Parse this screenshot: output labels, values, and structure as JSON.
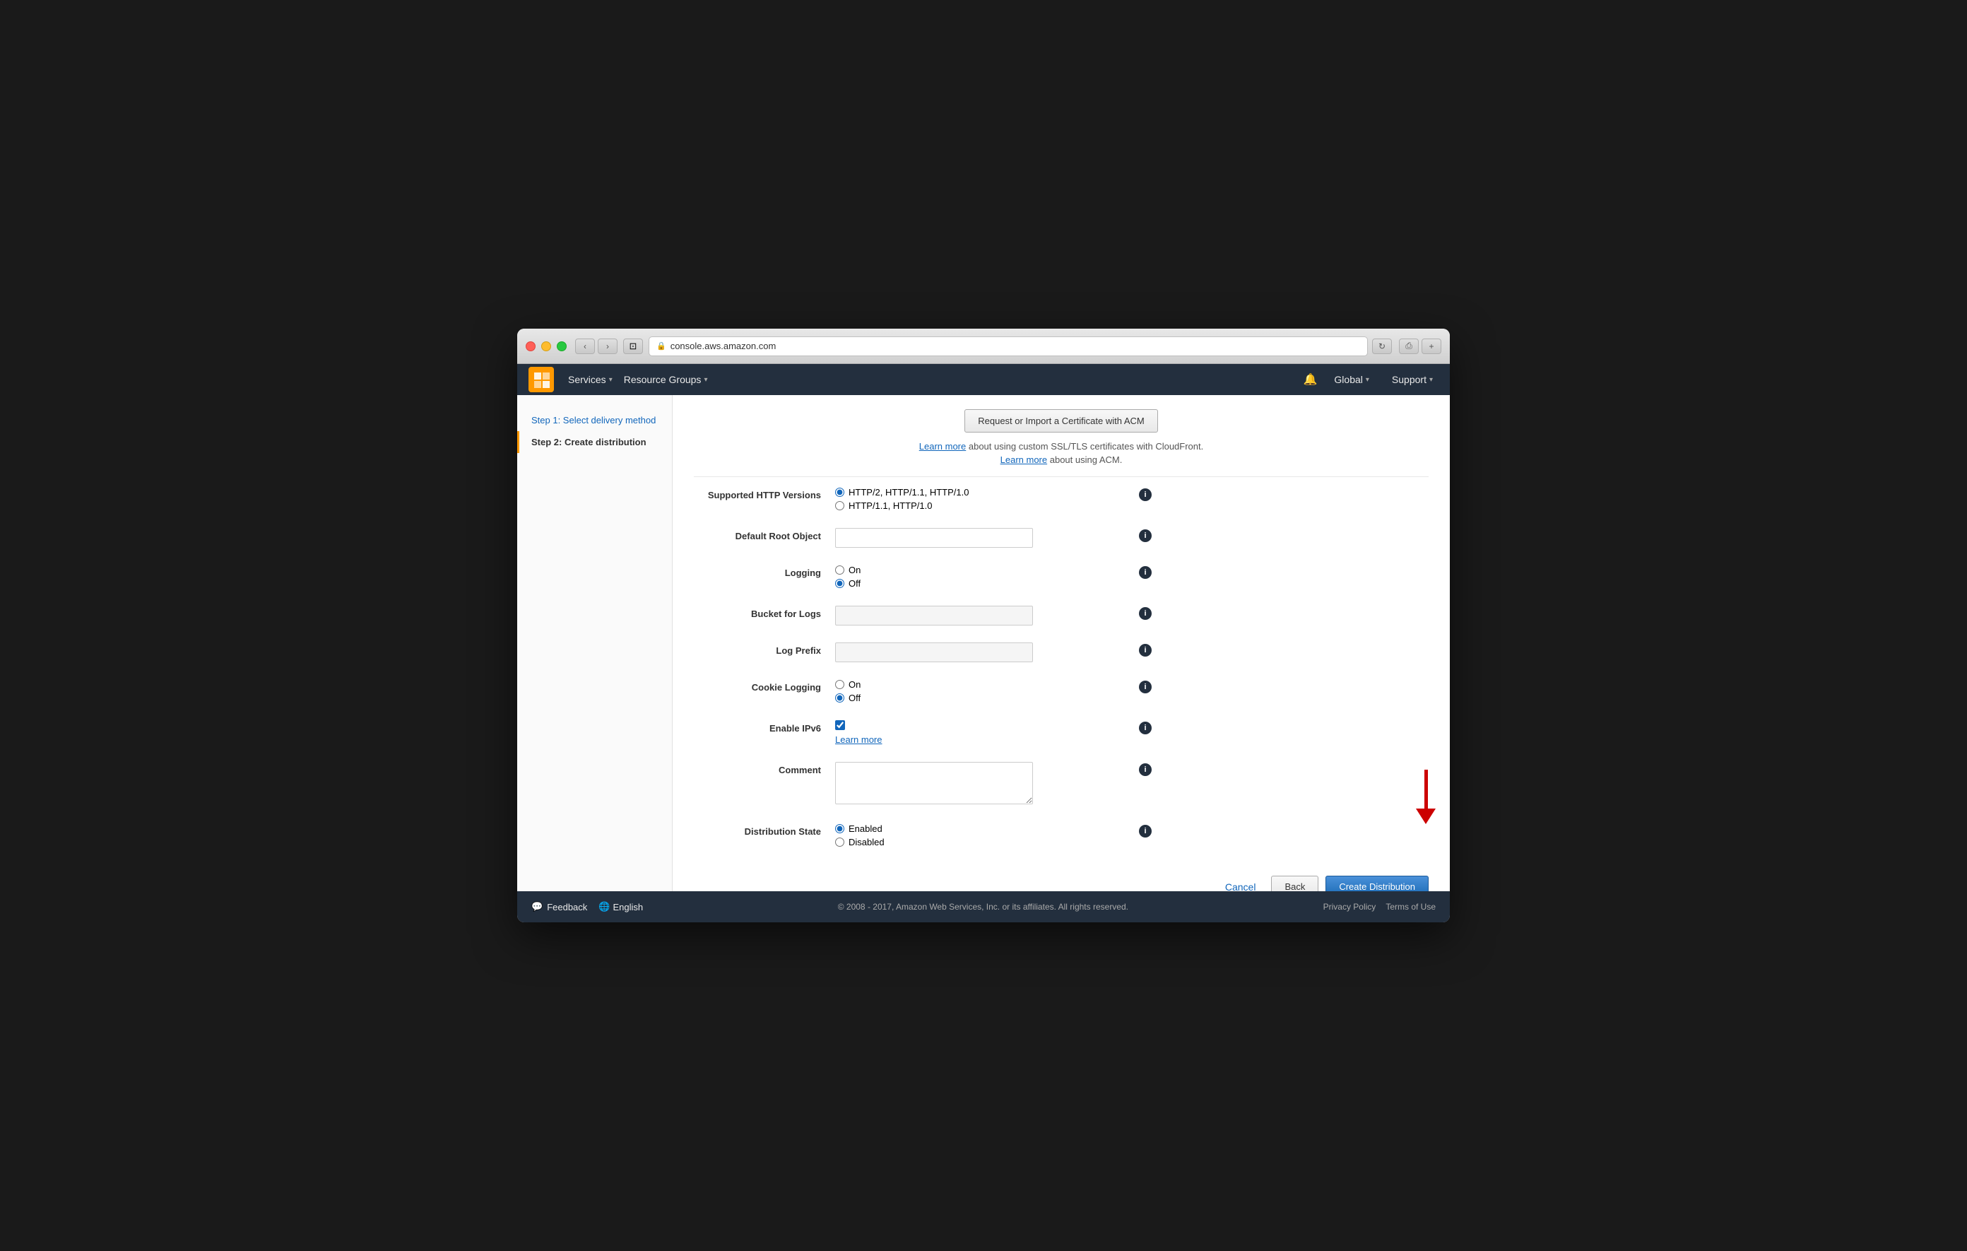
{
  "browser": {
    "url": "console.aws.amazon.com",
    "lock_icon": "🔒",
    "reload_icon": "↻",
    "back_icon": "‹",
    "forward_icon": "›",
    "window_icon": "⊡",
    "share_icon": "⎙",
    "plus_icon": "+"
  },
  "nav": {
    "logo_icon": "▣",
    "services_label": "Services",
    "resource_groups_label": "Resource Groups",
    "bell_icon": "🔔",
    "global_label": "Global",
    "support_label": "Support"
  },
  "sidebar": {
    "items": [
      {
        "label": "Step 1: Select delivery method",
        "type": "link"
      },
      {
        "label": "Step 2: Create distribution",
        "type": "active"
      }
    ]
  },
  "content": {
    "request_cert_btn": "Request or Import a Certificate with ACM",
    "learn_more_1": "Learn more",
    "learn_more_1_suffix": " about using custom SSL/TLS certificates with CloudFront.",
    "learn_more_2": "Learn more",
    "learn_more_2_suffix": " about using ACM.",
    "sections": {
      "http_versions": {
        "label": "Supported HTTP Versions",
        "option1": "HTTP/2, HTTP/1.1, HTTP/1.0",
        "option2": "HTTP/1.1, HTTP/1.0",
        "selected": "option1"
      },
      "default_root": {
        "label": "Default Root Object",
        "value": "",
        "placeholder": ""
      },
      "logging": {
        "label": "Logging",
        "option1": "On",
        "option2": "Off",
        "selected": "option2"
      },
      "bucket_logs": {
        "label": "Bucket for Logs",
        "value": "",
        "placeholder": ""
      },
      "log_prefix": {
        "label": "Log Prefix",
        "value": "",
        "placeholder": ""
      },
      "cookie_logging": {
        "label": "Cookie Logging",
        "option1": "On",
        "option2": "Off",
        "selected": "option2"
      },
      "ipv6": {
        "label": "Enable IPv6",
        "checked": true,
        "learn_more": "Learn more"
      },
      "comment": {
        "label": "Comment",
        "value": "",
        "placeholder": ""
      },
      "distribution_state": {
        "label": "Distribution State",
        "option1": "Enabled",
        "option2": "Disabled",
        "selected": "option1"
      }
    },
    "actions": {
      "cancel": "Cancel",
      "back": "Back",
      "create": "Create Distribution"
    }
  },
  "footer": {
    "feedback_icon": "💬",
    "feedback_label": "Feedback",
    "globe_icon": "🌐",
    "english_label": "English",
    "copyright": "© 2008 - 2017, Amazon Web Services, Inc. or its affiliates. All rights reserved.",
    "privacy_policy": "Privacy Policy",
    "terms_of_use": "Terms of Use"
  }
}
